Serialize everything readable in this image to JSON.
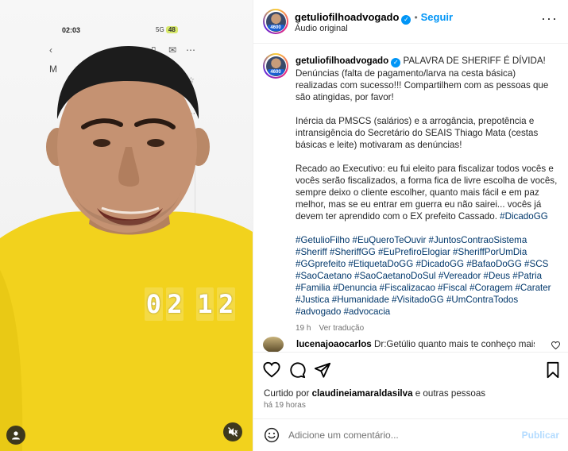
{
  "media": {
    "phone_time": "02:03",
    "phone_signal": "5G",
    "phone_battery": "48",
    "phone_letter": "M",
    "timer_digits": [
      "0",
      "2",
      "1",
      "2"
    ]
  },
  "post": {
    "username": "getuliofilhoadvogado",
    "avatar_badge": "4600",
    "follow_label": "Seguir",
    "audio_label": "Áudio original"
  },
  "caption": {
    "username": "getuliofilhoadvogado",
    "p1": "PALAVRA DE SHERIFF É DÍVIDA! Denúncias (falta de pagamento/larva na cesta básica) realizadas com sucesso!!! Compartilhem com as pessoas que são atingidas, por favor!",
    "p2": "Inércia da PMSCS (salários) e a arrogância, prepotência e intransigência do Secretário do SEAIS Thiago Mata (cestas básicas e leite) motivaram as denúncias!",
    "p3": "Recado ao Executivo: eu fui eleito para fiscalizar todos vocês e vocês serão fiscalizados, a forma fica de livre escolha de vocês, sempre deixo o cliente escolher, quanto mais fácil e em paz melhor, mas se eu entrar em guerra eu não sairei... vocês já devem ter aprendido com o EX prefeito Cassado.",
    "p3_tag": "#DicadoGG",
    "hashtags": "#GetulioFilho #EuQueroTeOuvir #JuntosContraoSistema #Sheriff #SheriffGG #EuPrefiroElogiar #SheriffPorUmDia #GGprefeito #EtiquetaDoGG #DicadoGG #BafaoDoGG #SCS #SaoCaetano #SaoCaetanoDoSul #Vereador #Deus #Patria #Familia #Denuncia #Fiscalizacao #Fiscal #Coragem #Carater #Justica #Humanidade #VisitadoGG #UmContraTodos #advogado #advocacia",
    "time": "19 h",
    "translate_label": "Ver tradução"
  },
  "comment": {
    "username": "lucenajoaocarlos",
    "text": "Dr:Getúlio quanto mais te conheço mais o"
  },
  "likes": {
    "prefix": "Curtido por ",
    "user": "claudineiamaraldasilva",
    "suffix": " e outras pessoas",
    "time_ago": "há 19 horas"
  },
  "comment_box": {
    "placeholder": "Adicione um comentário...",
    "publish_label": "Publicar"
  },
  "colors": {
    "accent": "#0095f6",
    "shirt": "#f2d21d",
    "hashtag": "#00376b"
  }
}
